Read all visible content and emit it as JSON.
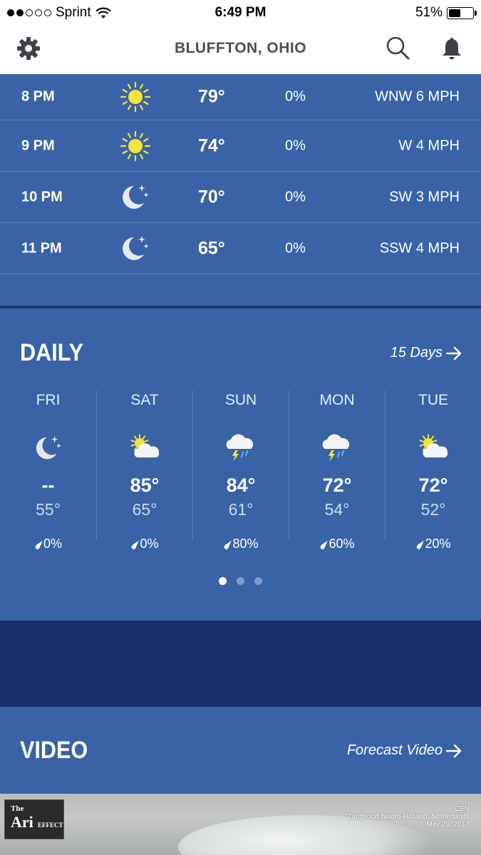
{
  "status_bar": {
    "carrier": "Sprint",
    "time": "6:49 PM",
    "battery": "51%",
    "battery_level": 0.51,
    "signal_dots_filled": 2,
    "signal_dots_total": 5
  },
  "header": {
    "title": "BLUFFTON, OHIO",
    "icons": [
      "gear-icon",
      "search-icon",
      "bell-icon"
    ]
  },
  "hourly": [
    {
      "time": "8 PM",
      "icon": "sun-icon",
      "temp": "79°",
      "precip": "0%",
      "wind": "WNW 6 MPH"
    },
    {
      "time": "9 PM",
      "icon": "sun-icon",
      "temp": "74°",
      "precip": "0%",
      "wind": "W 4 MPH"
    },
    {
      "time": "10 PM",
      "icon": "moon-icon",
      "temp": "70°",
      "precip": "0%",
      "wind": "SW 3 MPH"
    },
    {
      "time": "11 PM",
      "icon": "moon-icon",
      "temp": "65°",
      "precip": "0%",
      "wind": "SSW 4 MPH"
    }
  ],
  "daily": {
    "title": "DAILY",
    "link": "15 Days",
    "days": [
      {
        "name": "FRI",
        "icon": "moon-icon",
        "hi": "--",
        "lo": "55°",
        "precip": "0%"
      },
      {
        "name": "SAT",
        "icon": "partly-cloudy-icon",
        "hi": "85°",
        "lo": "65°",
        "precip": "0%"
      },
      {
        "name": "SUN",
        "icon": "thunderstorm-icon",
        "hi": "84°",
        "lo": "61°",
        "precip": "80%"
      },
      {
        "name": "MON",
        "icon": "thunderstorm-icon",
        "hi": "72°",
        "lo": "54°",
        "precip": "60%"
      },
      {
        "name": "TUE",
        "icon": "partly-cloudy-icon",
        "hi": "72°",
        "lo": "52°",
        "precip": "20%"
      }
    ],
    "pager": {
      "pages": 3,
      "active": 0
    }
  },
  "video": {
    "title": "VIDEO",
    "link": "Forecast Video",
    "thumb": {
      "logo_the": "The",
      "logo_ari": "Ari",
      "logo_effect": "EFFECT",
      "caption_line1": "CEN",
      "caption_line2": "Zandvoort Noord-Holland, Netherlands",
      "caption_line3": "May 29, 2017"
    }
  },
  "colors": {
    "background": "#3a63a7",
    "ad_band": "#1a2f6b",
    "sun": "#f5e23a",
    "header_text": "#4a5057"
  }
}
